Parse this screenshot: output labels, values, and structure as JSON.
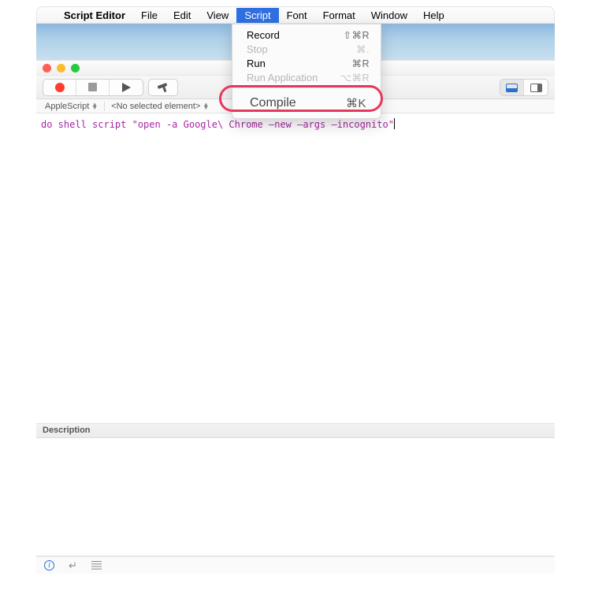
{
  "menubar": {
    "app": "Script Editor",
    "items": [
      "File",
      "Edit",
      "View",
      "Script",
      "Font",
      "Format",
      "Window",
      "Help"
    ],
    "active_index": 3
  },
  "dropdown": {
    "items": [
      {
        "label": "Record",
        "shortcut": "⇧⌘R",
        "disabled": false
      },
      {
        "label": "Stop",
        "shortcut": "⌘.",
        "disabled": true
      },
      {
        "label": "Run",
        "shortcut": "⌘R",
        "disabled": false
      },
      {
        "label": "Run Application",
        "shortcut": "⌥⌘R",
        "disabled": true
      }
    ],
    "compile": {
      "label": "Compile",
      "shortcut": "⌘K"
    }
  },
  "popupbar": {
    "language": "AppleScript",
    "element": "<No selected element>"
  },
  "code": "do shell script \"open -a Google\\ Chrome –new –args –incognito\"",
  "desc": {
    "header": "Description"
  }
}
